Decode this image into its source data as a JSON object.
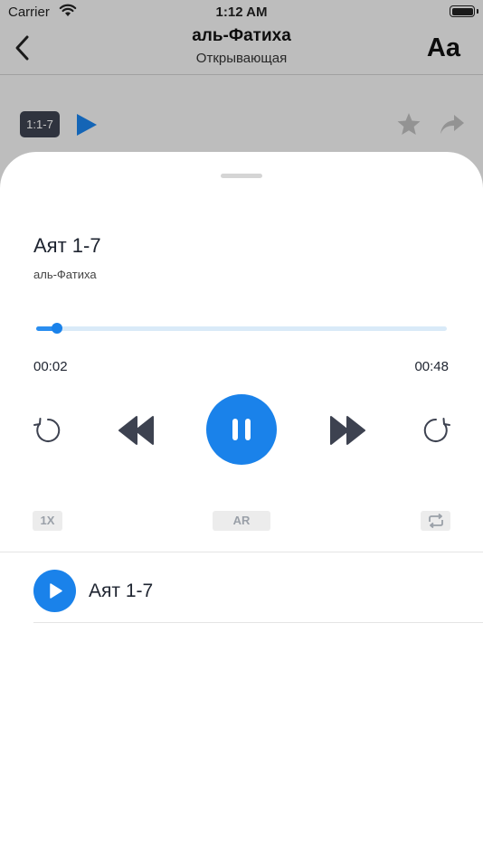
{
  "status_bar": {
    "carrier": "Carrier",
    "time": "1:12 AM"
  },
  "nav": {
    "title": "аль-Фатиха",
    "subtitle": "Открывающая",
    "font_button": "Aa"
  },
  "ayah_row": {
    "badge": "1:1-7"
  },
  "player": {
    "title": "Аят 1-7",
    "subtitle": "аль-Фатиха",
    "current_time": "00:02",
    "total_time": "00:48",
    "progress_fraction": 0.05,
    "speed": "1X",
    "language": "AR"
  },
  "playlist": [
    {
      "label": "Аят 1-7"
    }
  ],
  "colors": {
    "accent": "#1a82ea",
    "accent_light": "#d9eaf8",
    "text": "#1e2430",
    "chip_bg": "#ececec",
    "chip_text": "#9aa0a8"
  },
  "icons": {
    "back": "chevron-left-icon",
    "play": "play-icon",
    "star": "star-icon",
    "share": "share-icon",
    "rewind": "rewind-icon",
    "previous": "previous-icon",
    "pause": "pause-icon",
    "next": "next-icon",
    "forward": "forward-icon",
    "repeat": "repeat-icon"
  }
}
